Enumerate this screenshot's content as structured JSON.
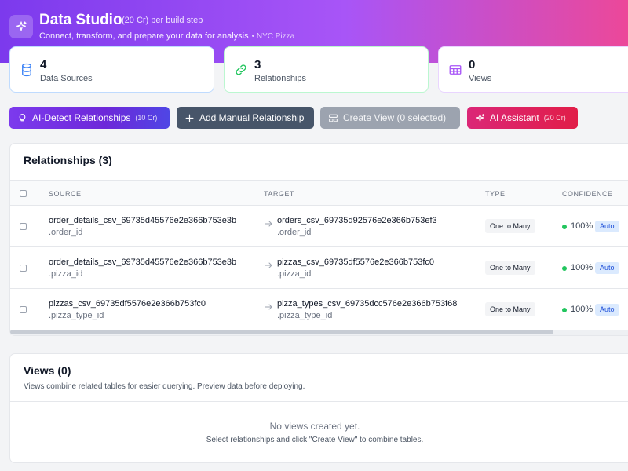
{
  "header": {
    "title": "Data Studio",
    "cost": "(20 Cr) per build step",
    "subtitle": "Connect, transform, and prepare your data for analysis",
    "project": "• NYC Pizza",
    "icon": "sparkles-icon"
  },
  "stats": [
    {
      "value": "4",
      "label": "Data Sources",
      "icon": "database-icon",
      "color": "#3b82f6",
      "border": "#bfdbfe"
    },
    {
      "value": "3",
      "label": "Relationships",
      "icon": "link-icon",
      "color": "#22c55e",
      "border": "#bbf7d0"
    },
    {
      "value": "0",
      "label": "Views",
      "icon": "table-icon",
      "color": "#a855f7",
      "border": "#e9d5ff"
    }
  ],
  "toolbar": {
    "ai_detect_label": "AI-Detect Relationships",
    "ai_detect_cost": "(10 Cr)",
    "manual_label": "Add Manual Relationship",
    "create_view_label": "Create View (0 selected)",
    "assistant_label": "AI Assistant",
    "assistant_cost": "(20 Cr)"
  },
  "relationships": {
    "title": "Relationships (3)",
    "columns": {
      "source": "SOURCE",
      "target": "TARGET",
      "type": "TYPE",
      "confidence": "CONFIDENCE"
    },
    "rows": [
      {
        "source_table": "order_details_csv_69735d45576e2e366b753e3b",
        "source_column": ".order_id",
        "target_table": "orders_csv_69735d92576e2e366b753ef3",
        "target_column": ".order_id",
        "type": "One to Many",
        "confidence": "100%",
        "method": "Auto"
      },
      {
        "source_table": "order_details_csv_69735d45576e2e366b753e3b",
        "source_column": ".pizza_id",
        "target_table": "pizzas_csv_69735df5576e2e366b753fc0",
        "target_column": ".pizza_id",
        "type": "One to Many",
        "confidence": "100%",
        "method": "Auto"
      },
      {
        "source_table": "pizzas_csv_69735df5576e2e366b753fc0",
        "source_column": ".pizza_type_id",
        "target_table": "pizza_types_csv_69735dcc576e2e366b753f68",
        "target_column": ".pizza_type_id",
        "type": "One to Many",
        "confidence": "100%",
        "method": "Auto"
      }
    ]
  },
  "views": {
    "title": "Views (0)",
    "description": "Views combine related tables for easier querying. Preview data before deploying.",
    "empty_title": "No views created yet.",
    "empty_subtitle": "Select relationships and click \"Create View\" to combine tables."
  }
}
